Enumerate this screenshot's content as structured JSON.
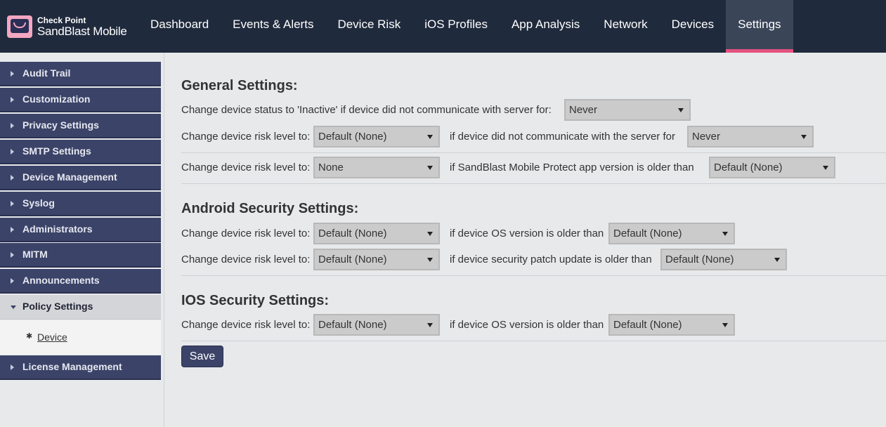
{
  "brand": {
    "line1": "Check Point",
    "line2": "SandBlast Mobile"
  },
  "nav": [
    {
      "label": "Dashboard"
    },
    {
      "label": "Events & Alerts"
    },
    {
      "label": "Device Risk"
    },
    {
      "label": "iOS Profiles"
    },
    {
      "label": "App Analysis"
    },
    {
      "label": "Network"
    },
    {
      "label": "Devices"
    },
    {
      "label": "Settings",
      "active": true
    }
  ],
  "sidebar": {
    "items": [
      {
        "label": "Audit Trail"
      },
      {
        "label": "Customization"
      },
      {
        "label": "Privacy Settings"
      },
      {
        "label": "SMTP Settings"
      },
      {
        "label": "Device Management"
      },
      {
        "label": "Syslog"
      },
      {
        "label": "Administrators"
      },
      {
        "label": "MITM"
      },
      {
        "label": "Announcements"
      },
      {
        "label": "Policy Settings",
        "open": true
      },
      {
        "label": "License Management"
      }
    ],
    "sub_item": "Device"
  },
  "general": {
    "title": "General Settings:",
    "row1": {
      "label": "Change device status to 'Inactive' if device did not communicate with server for:",
      "value": "Never"
    },
    "row2": {
      "label": "Change device risk level to:",
      "value": "Default (None)",
      "cond": "if device did not communicate with the server for",
      "cond_value": "Never"
    },
    "row3": {
      "label": "Change device risk level to:",
      "value": "None",
      "cond": "if SandBlast Mobile Protect app version is older than",
      "cond_value": "Default (None)"
    }
  },
  "android": {
    "title": "Android Security Settings:",
    "row1": {
      "label": "Change device risk level to:",
      "value": "Default (None)",
      "cond": "if device OS version is older than",
      "cond_value": "Default (None)"
    },
    "row2": {
      "label": "Change device risk level to:",
      "value": "Default (None)",
      "cond": "if device security patch update is older than",
      "cond_value": "Default (None)"
    }
  },
  "ios": {
    "title": "IOS Security Settings:",
    "row1": {
      "label": "Change device risk level to:",
      "value": "Default (None)",
      "cond": "if device OS version is older than",
      "cond_value": "Default (None)"
    }
  },
  "save_label": "Save",
  "colors": {
    "topbar": "#1f2a3c",
    "accent": "#e4527f",
    "sidebar": "#3b4368"
  }
}
